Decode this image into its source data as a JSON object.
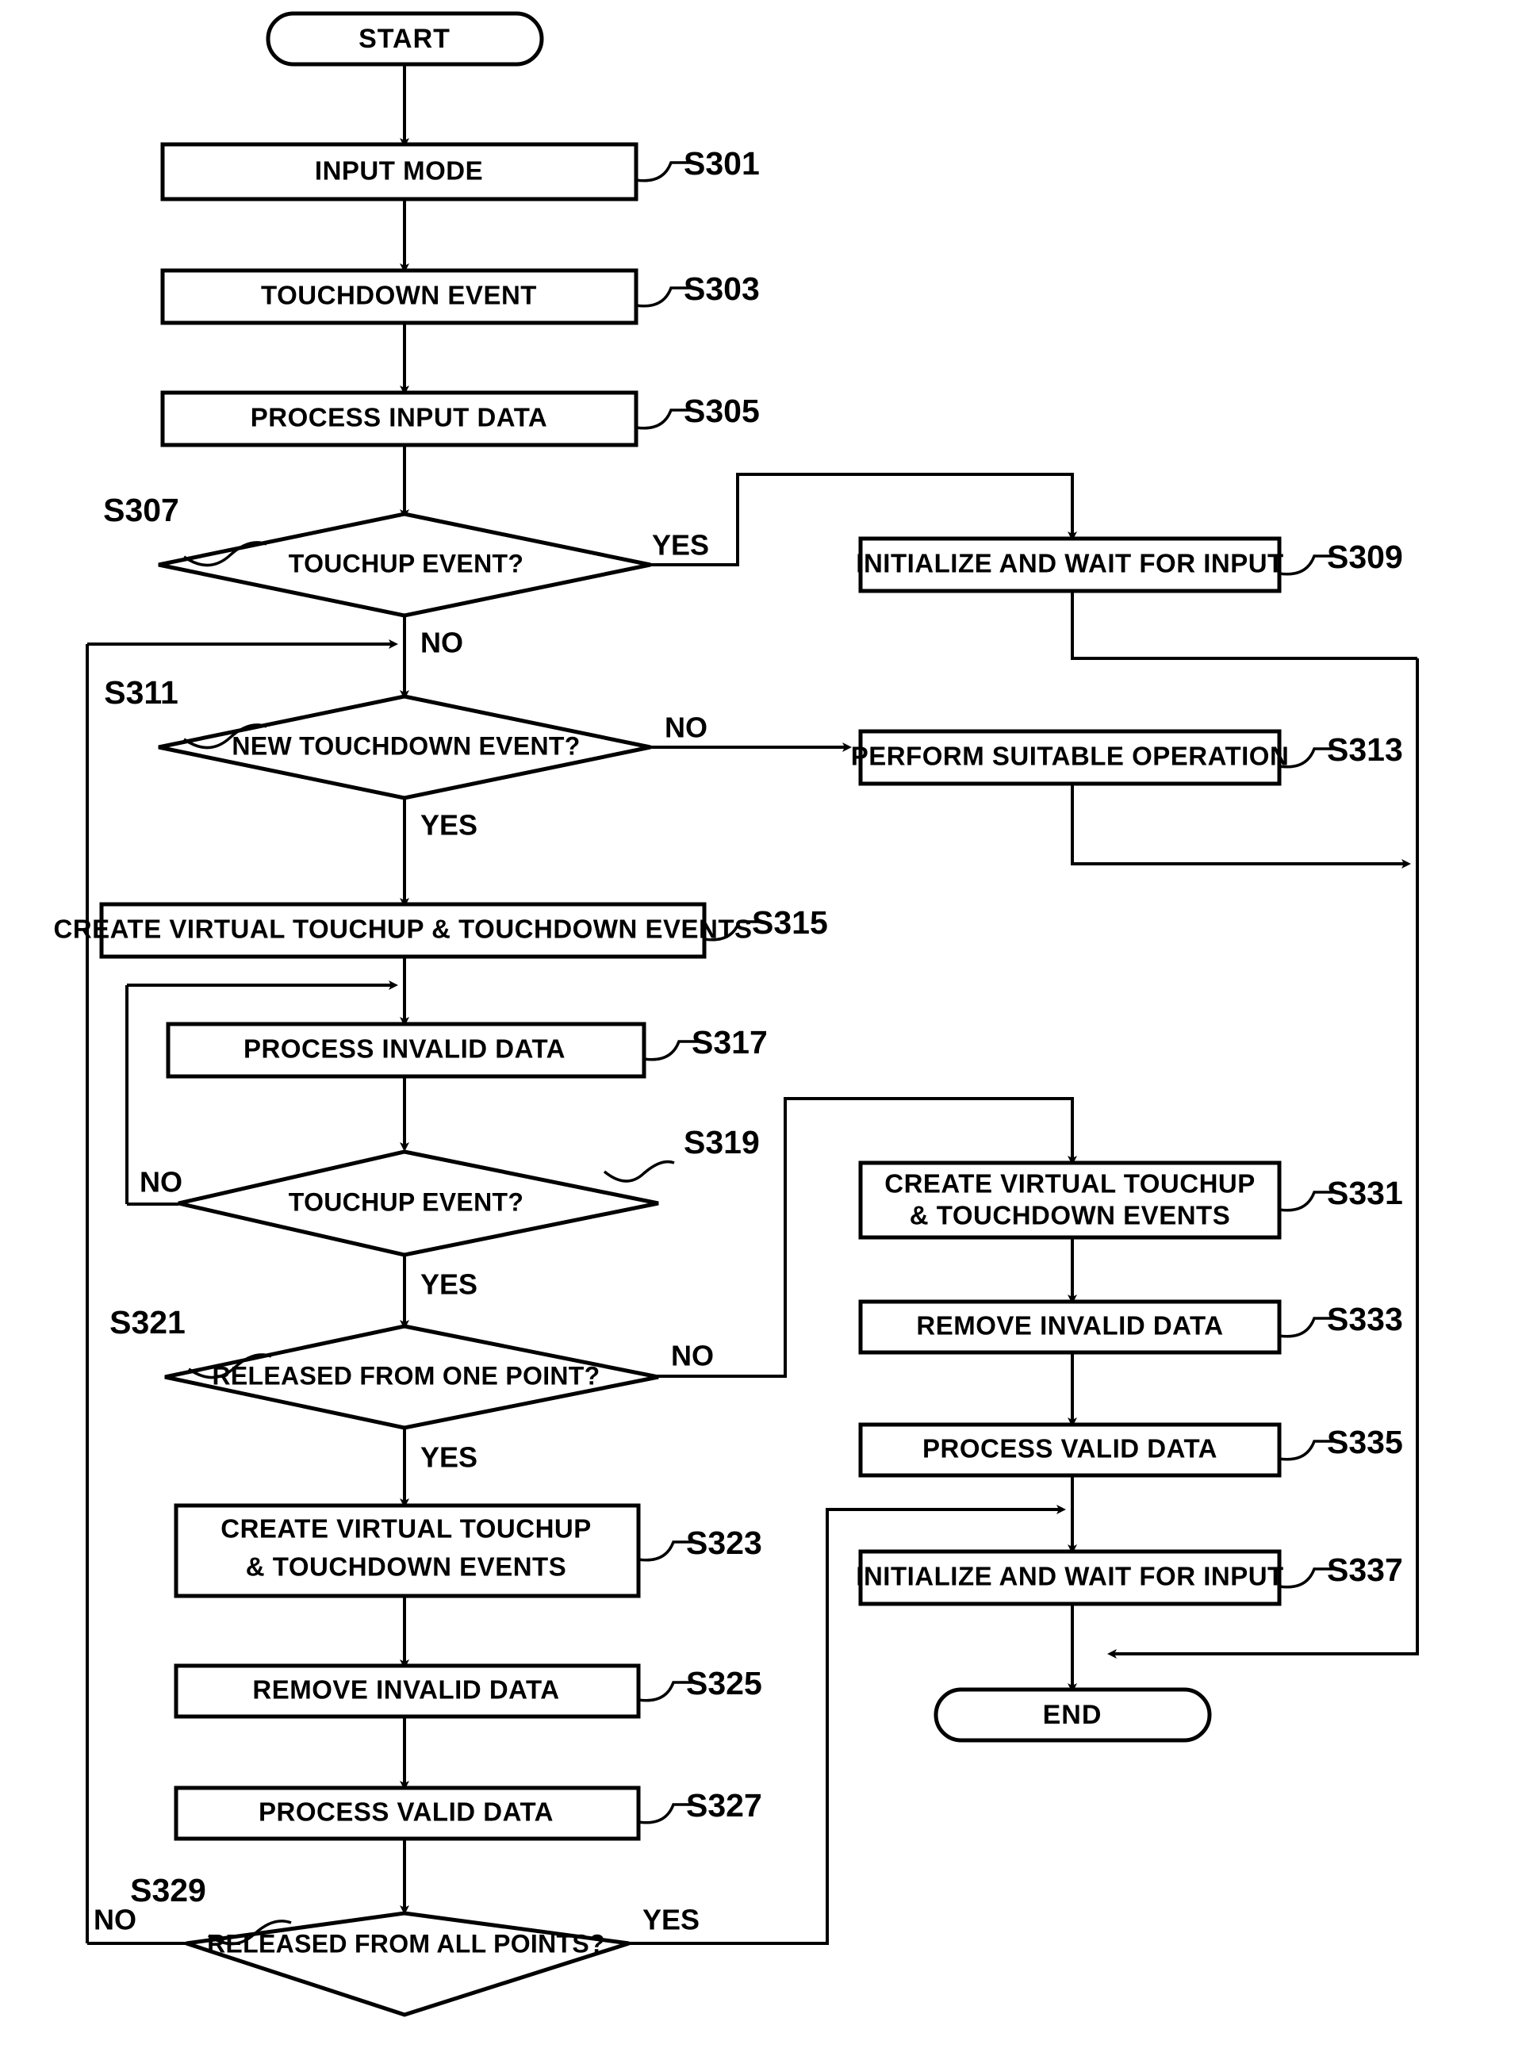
{
  "diagram": {
    "type": "flowchart",
    "title": "Touch input event processing flowchart",
    "terminals": {
      "start": "START",
      "end": "END"
    },
    "branch_labels": {
      "yes": "YES",
      "no": "NO"
    },
    "nodes": [
      {
        "id": "start",
        "kind": "terminator",
        "label": "START",
        "ref": ""
      },
      {
        "id": "s301",
        "kind": "process",
        "label": "INPUT MODE",
        "ref": "S301"
      },
      {
        "id": "s303",
        "kind": "process",
        "label": "TOUCHDOWN EVENT",
        "ref": "S303"
      },
      {
        "id": "s305",
        "kind": "process",
        "label": "PROCESS INPUT DATA",
        "ref": "S305"
      },
      {
        "id": "s307",
        "kind": "decision",
        "label": "TOUCHUP EVENT?",
        "ref": "S307"
      },
      {
        "id": "s309",
        "kind": "process",
        "label": "INITIALIZE AND WAIT FOR INPUT",
        "ref": "S309"
      },
      {
        "id": "s311",
        "kind": "decision",
        "label": "NEW TOUCHDOWN EVENT?",
        "ref": "S311"
      },
      {
        "id": "s313",
        "kind": "process",
        "label": "PERFORM SUITABLE OPERATION",
        "ref": "S313"
      },
      {
        "id": "s315",
        "kind": "process",
        "label": "CREATE VIRTUAL TOUCHUP & TOUCHDOWN EVENTS",
        "ref": "S315"
      },
      {
        "id": "s317",
        "kind": "process",
        "label": "PROCESS INVALID DATA",
        "ref": "S317"
      },
      {
        "id": "s319",
        "kind": "decision",
        "label": "TOUCHUP EVENT?",
        "ref": "S319"
      },
      {
        "id": "s321",
        "kind": "decision",
        "label": "RELEASED FROM ONE POINT?",
        "ref": "S321"
      },
      {
        "id": "s323",
        "kind": "process",
        "label": "CREATE VIRTUAL TOUCHUP\n& TOUCHDOWN EVENTS",
        "ref": "S323"
      },
      {
        "id": "s325",
        "kind": "process",
        "label": "REMOVE INVALID DATA",
        "ref": "S325"
      },
      {
        "id": "s327",
        "kind": "process",
        "label": "PROCESS VALID DATA",
        "ref": "S327"
      },
      {
        "id": "s329",
        "kind": "decision",
        "label": "RELEASED FROM ALL POINTS?",
        "ref": "S329"
      },
      {
        "id": "s331",
        "kind": "process",
        "label": "CREATE VIRTUAL TOUCHUP\n& TOUCHDOWN EVENTS",
        "ref": "S331"
      },
      {
        "id": "s333",
        "kind": "process",
        "label": "REMOVE INVALID DATA",
        "ref": "S333"
      },
      {
        "id": "s335",
        "kind": "process",
        "label": "PROCESS VALID DATA",
        "ref": "S335"
      },
      {
        "id": "s337",
        "kind": "process",
        "label": "INITIALIZE AND WAIT FOR INPUT",
        "ref": "S337"
      },
      {
        "id": "end",
        "kind": "terminator",
        "label": "END",
        "ref": ""
      }
    ],
    "node_text": {
      "start": "START",
      "s301": "INPUT MODE",
      "s303": "TOUCHDOWN EVENT",
      "s305": "PROCESS INPUT DATA",
      "s307": "TOUCHUP EVENT?",
      "s309": "INITIALIZE AND WAIT FOR INPUT",
      "s311": "NEW TOUCHDOWN EVENT?",
      "s313": "PERFORM SUITABLE OPERATION",
      "s315": "CREATE VIRTUAL TOUCHUP & TOUCHDOWN EVENTS",
      "s317": "PROCESS INVALID DATA",
      "s319": "TOUCHUP EVENT?",
      "s321": "RELEASED FROM ONE POINT?",
      "s323_line1": "CREATE VIRTUAL TOUCHUP",
      "s323_line2": "& TOUCHDOWN EVENTS",
      "s325": "REMOVE INVALID DATA",
      "s327": "PROCESS VALID DATA",
      "s329": "RELEASED FROM ALL POINTS?",
      "s331_line1": "CREATE VIRTUAL TOUCHUP",
      "s331_line2": "& TOUCHDOWN EVENTS",
      "s333": "REMOVE INVALID DATA",
      "s335": "PROCESS VALID DATA",
      "s337": "INITIALIZE AND WAIT FOR INPUT",
      "end": "END"
    },
    "step_refs": {
      "s301": "S301",
      "s303": "S303",
      "s305": "S305",
      "s307": "S307",
      "s309": "S309",
      "s311": "S311",
      "s313": "S313",
      "s315": "S315",
      "s317": "S317",
      "s319": "S319",
      "s321": "S321",
      "s323": "S323",
      "s325": "S325",
      "s327": "S327",
      "s329": "S329",
      "s331": "S331",
      "s333": "S333",
      "s335": "S335",
      "s337": "S337"
    },
    "branches": {
      "s307_yes": "YES",
      "s307_no": "NO",
      "s311_yes": "YES",
      "s311_no": "NO",
      "s319_yes": "YES",
      "s319_no": "NO",
      "s321_yes": "YES",
      "s321_no": "NO",
      "s329_yes": "YES",
      "s329_no": "NO"
    },
    "colors": {
      "stroke": "#000000",
      "fill": "#ffffff",
      "background": "#ffffff"
    }
  }
}
